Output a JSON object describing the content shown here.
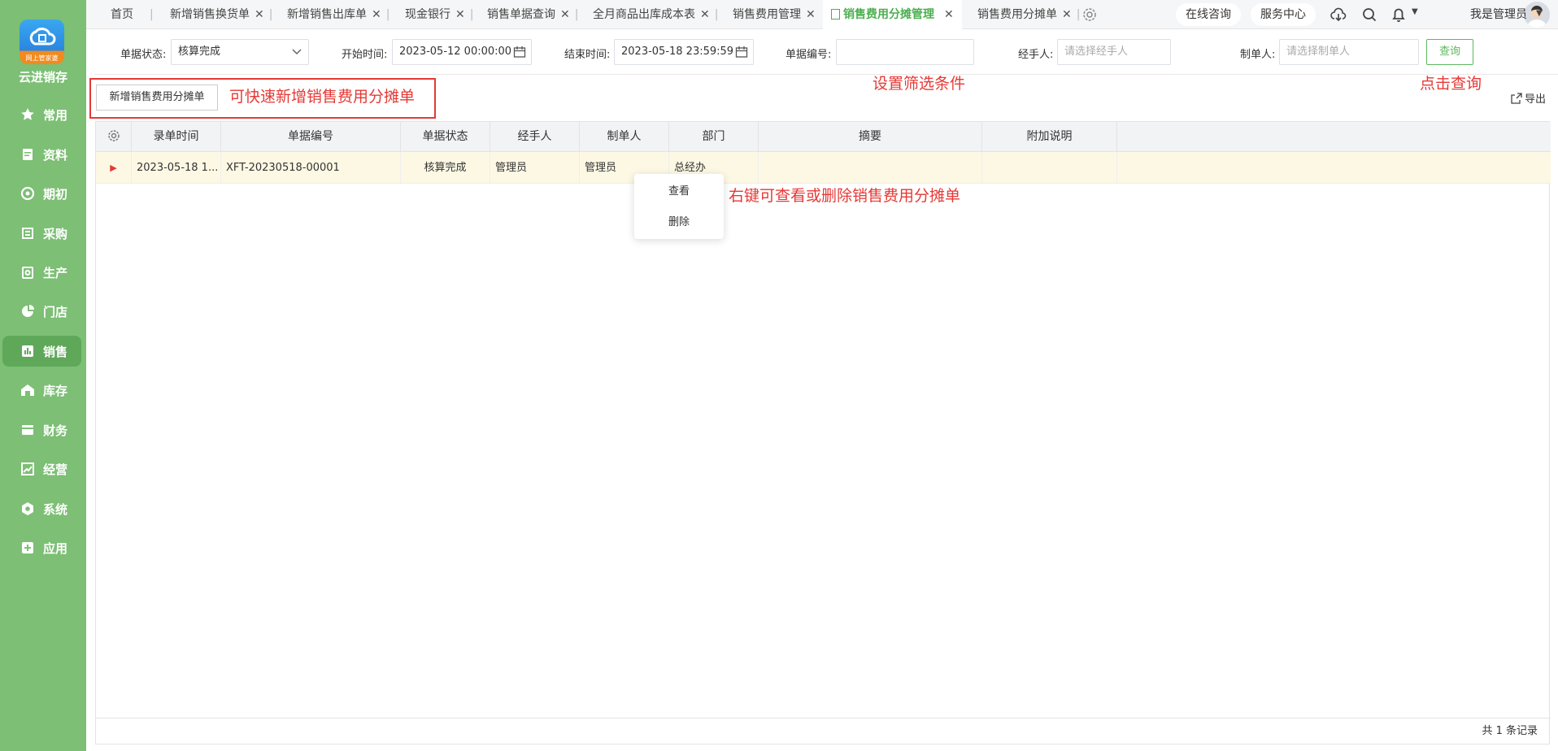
{
  "sidebar": {
    "logo_text": "网上管家婆",
    "brand": "云进销存",
    "items": [
      {
        "label": "常用",
        "icon": "star-icon"
      },
      {
        "label": "资料",
        "icon": "document-icon"
      },
      {
        "label": "期初",
        "icon": "clock-icon"
      },
      {
        "label": "采购",
        "icon": "cart-icon"
      },
      {
        "label": "生产",
        "icon": "factory-icon"
      },
      {
        "label": "门店",
        "icon": "pie-icon"
      },
      {
        "label": "销售",
        "icon": "chart-icon"
      },
      {
        "label": "库存",
        "icon": "warehouse-icon"
      },
      {
        "label": "财务",
        "icon": "wallet-icon"
      },
      {
        "label": "经营",
        "icon": "trend-icon"
      },
      {
        "label": "系统",
        "icon": "gear-icon"
      },
      {
        "label": "应用",
        "icon": "plus-icon"
      }
    ],
    "active_index": 6
  },
  "tabs": [
    {
      "label": "首页"
    },
    {
      "label": "新增销售换货单"
    },
    {
      "label": "新增销售出库单"
    },
    {
      "label": "现金银行"
    },
    {
      "label": "销售单据查询"
    },
    {
      "label": "全月商品出库成本表"
    },
    {
      "label": "销售费用管理"
    },
    {
      "label": "销售费用分摊管理"
    },
    {
      "label": "销售费用分摊单"
    }
  ],
  "top_right": {
    "consult": "在线咨询",
    "service": "服务中心",
    "user": "我是管理员"
  },
  "filters": {
    "status_label": "单据状态:",
    "status_value": "核算完成",
    "start_label": "开始时间:",
    "start_value": "2023-05-12 00:00:00",
    "end_label": "结束时间:",
    "end_value": "2023-05-18 23:59:59",
    "code_label": "单据编号:",
    "code_value": "",
    "handler_label": "经手人:",
    "handler_placeholder": "请选择经手人",
    "maker_label": "制单人:",
    "maker_placeholder": "请选择制单人",
    "query_button": "查询"
  },
  "toolbar": {
    "add_button": "新增销售费用分摊单",
    "export": "导出"
  },
  "annotations": {
    "add_hint": "可快速新增销售费用分摊单",
    "filter_hint": "设置筛选条件",
    "query_hint": "点击查询",
    "context_hint": "右键可查看或删除销售费用分摊单"
  },
  "table": {
    "columns": [
      "录单时间",
      "单据编号",
      "单据状态",
      "经手人",
      "制单人",
      "部门",
      "摘要",
      "附加说明"
    ],
    "rows": [
      {
        "time": "2023-05-18 1...",
        "code": "XFT-20230518-00001",
        "status": "核算完成",
        "handler": "管理员",
        "maker": "管理员",
        "dept": "总经办",
        "summary": "",
        "note": ""
      }
    ],
    "record_count": "共 1 条记录"
  },
  "context_menu": {
    "view": "查看",
    "delete": "删除"
  }
}
